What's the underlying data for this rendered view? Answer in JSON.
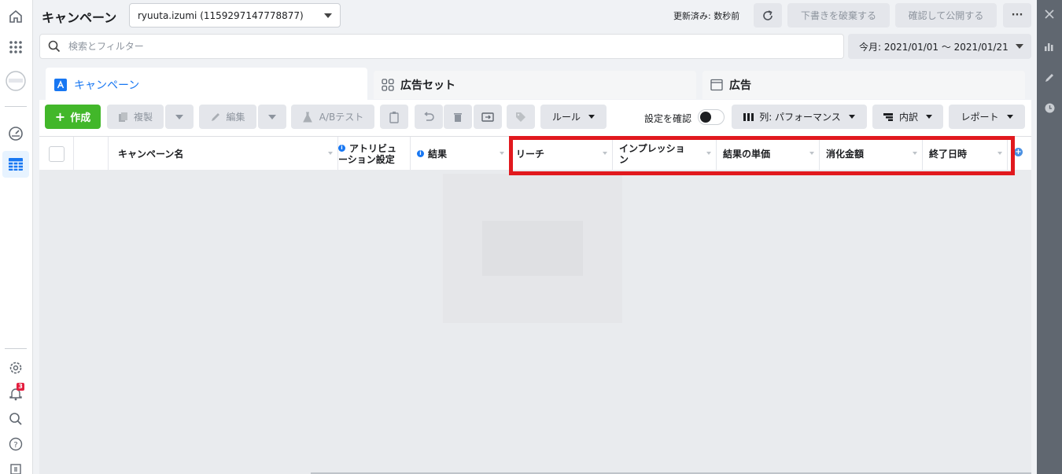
{
  "page": {
    "title": "キャンペーン"
  },
  "account": {
    "label": "ryuuta.izumi (1159297147778877)"
  },
  "status": {
    "updated": "更新済み: 数秒前",
    "discard_label": "下書きを破棄する",
    "publish_label": "確認して公開する",
    "more_label": "···"
  },
  "search": {
    "placeholder": "検索とフィルター"
  },
  "date_range": {
    "label": "今月: 2021/01/01 〜 2021/01/21"
  },
  "tabs": [
    {
      "label": "キャンペーン"
    },
    {
      "label": "広告セット"
    },
    {
      "label": "広告"
    }
  ],
  "toolbar": {
    "create": "作成",
    "duplicate": "複製",
    "edit": "編集",
    "ab_test": "A/Bテスト",
    "rules": "ルール",
    "review_settings": "設定を確認",
    "columns": "列: パフォーマンス",
    "breakdown": "内訳",
    "reports": "レポート"
  },
  "columns": [
    {
      "label": "キャンペーン名"
    },
    {
      "label": "アトリビューション設定",
      "line1": "アトリビュ",
      "line2": "ーション設定"
    },
    {
      "label": "結果"
    },
    {
      "label": "リーチ"
    },
    {
      "label": "インプレッション",
      "line1": "インプレッショ",
      "line2": "ン"
    },
    {
      "label": "結果の単価"
    },
    {
      "label": "消化金額"
    },
    {
      "label": "終了日時"
    }
  ],
  "notifications": {
    "count": "3"
  },
  "colors": {
    "accent": "#1877f2",
    "create": "#42b72a",
    "highlight": "#e1191e",
    "badge": "#e41e3f"
  }
}
